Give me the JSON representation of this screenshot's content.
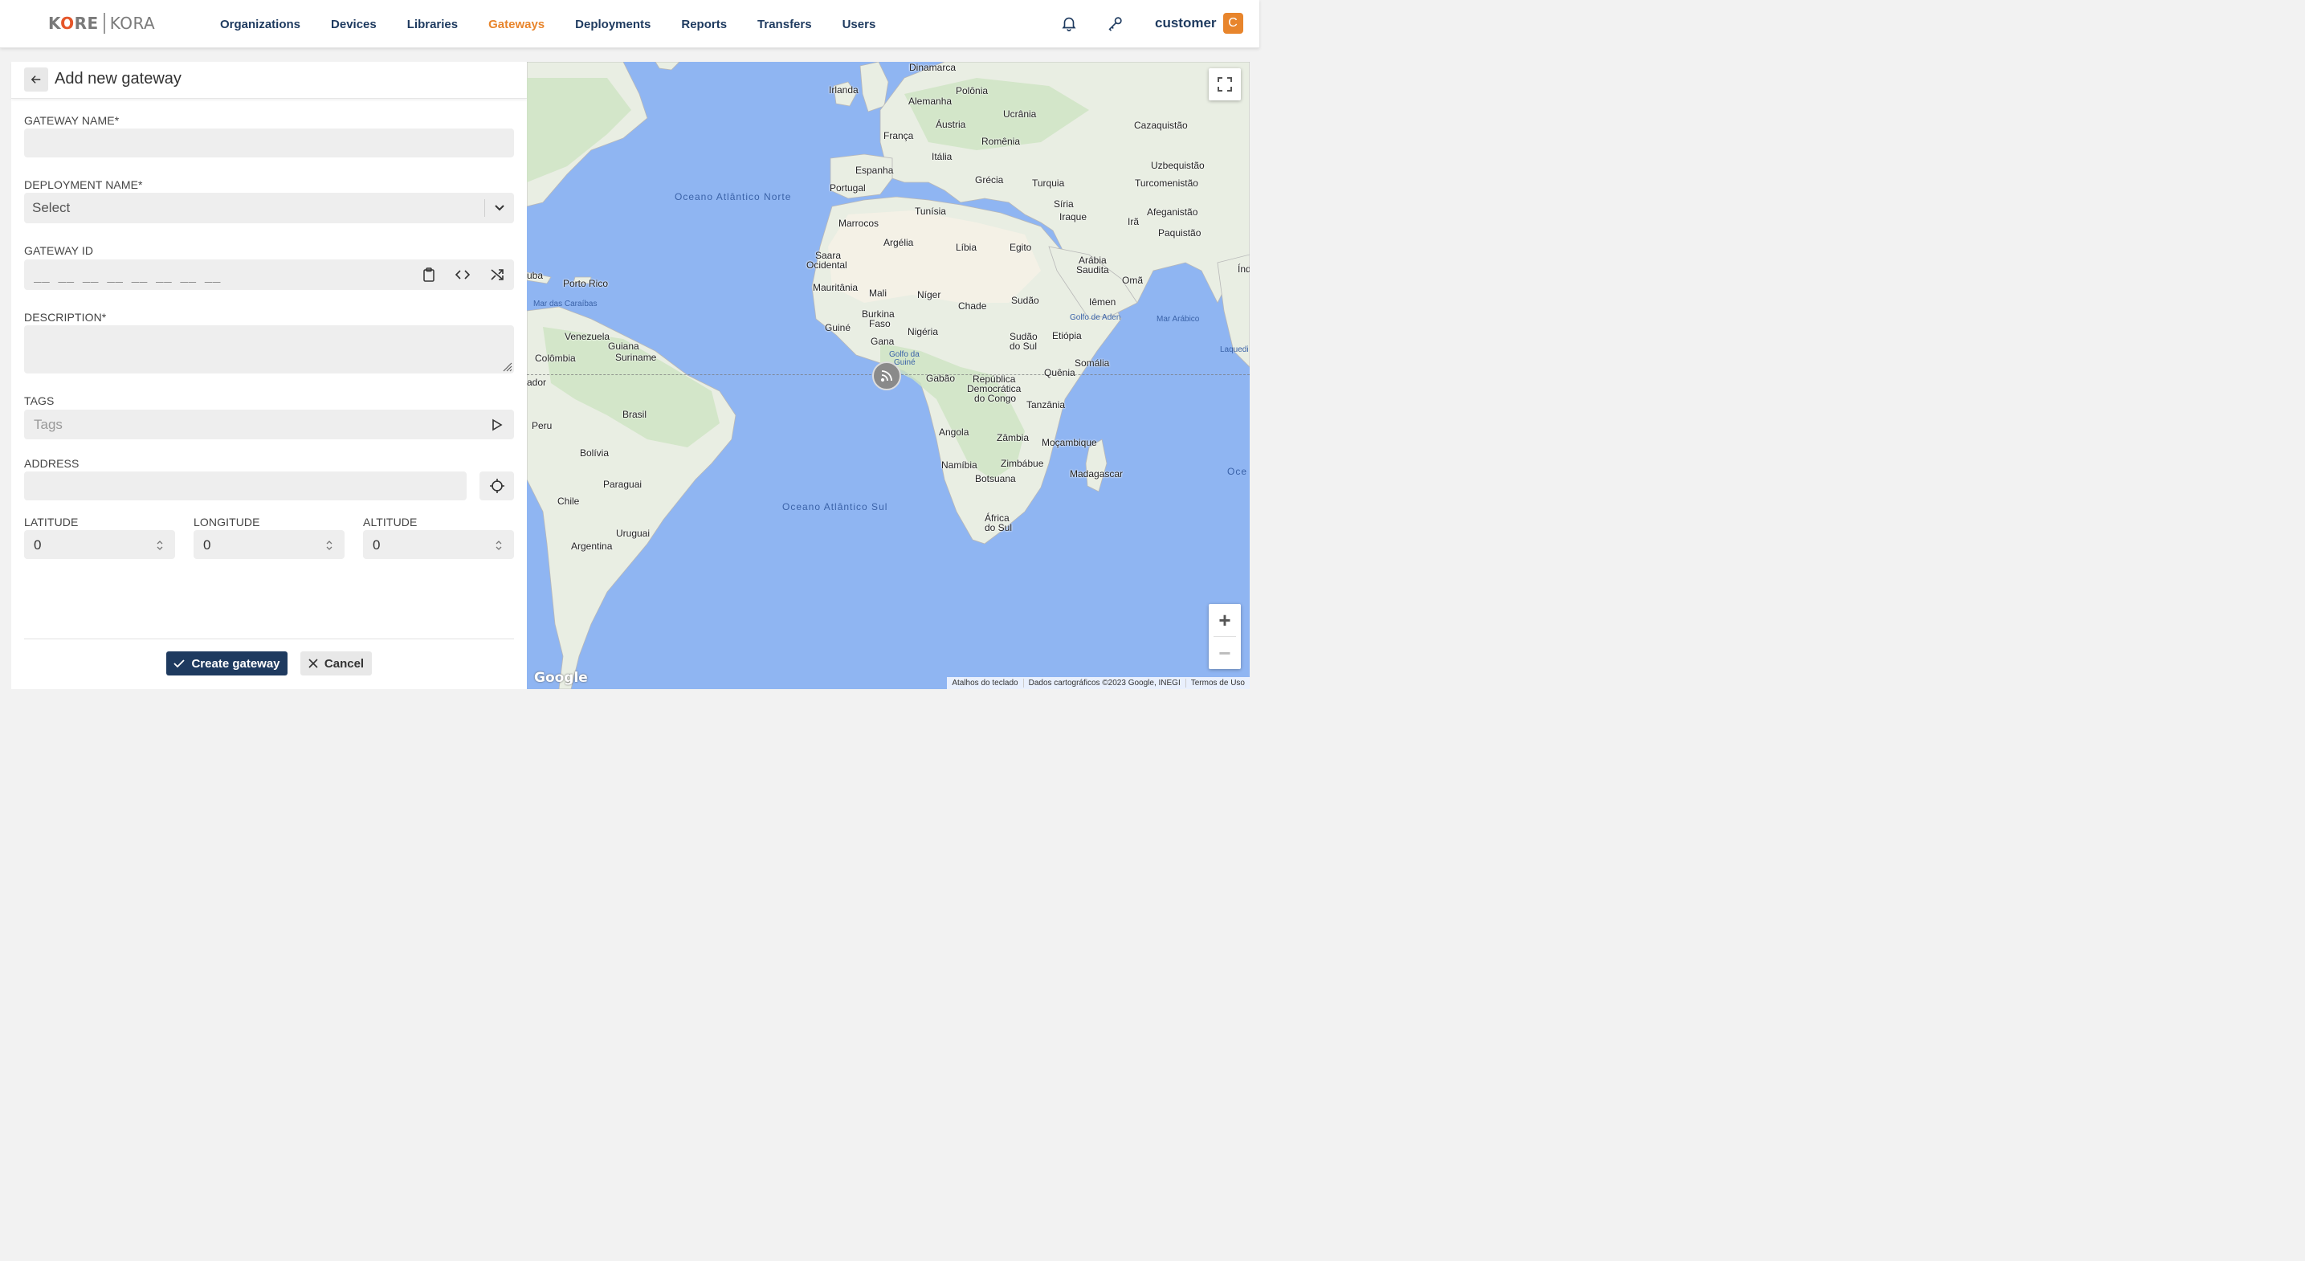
{
  "header": {
    "logo_left": "KORE",
    "logo_right": "KORA",
    "nav": [
      {
        "label": "Organizations",
        "active": false
      },
      {
        "label": "Devices",
        "active": false
      },
      {
        "label": "Libraries",
        "active": false
      },
      {
        "label": "Gateways",
        "active": true
      },
      {
        "label": "Deployments",
        "active": false
      },
      {
        "label": "Reports",
        "active": false
      },
      {
        "label": "Transfers",
        "active": false
      },
      {
        "label": "Users",
        "active": false
      }
    ],
    "notifications_icon": "bell-icon",
    "key_icon": "key-icon",
    "user_name": "customer",
    "avatar_letter": "C"
  },
  "form": {
    "title": "Add new gateway",
    "gateway_name_label": "GATEWAY NAME*",
    "gateway_name_value": "",
    "deployment_label": "DEPLOYMENT NAME*",
    "deployment_value": "Select",
    "gateway_id_label": "GATEWAY ID",
    "gateway_id_mask": "__ __ __ __ __ __ __ __",
    "description_label": "DESCRIPTION*",
    "description_value": "",
    "tags_label": "TAGS",
    "tags_placeholder": "Tags",
    "address_label": "ADDRESS",
    "address_value": "",
    "latitude_label": "LATITUDE",
    "latitude_value": "0",
    "longitude_label": "LONGITUDE",
    "longitude_value": "0",
    "altitude_label": "ALTITUDE",
    "altitude_value": "0",
    "create_label": "Create gateway",
    "cancel_label": "Cancel"
  },
  "map": {
    "labels": {
      "dinamarca": "Dinamarca",
      "irlanda": "Irlanda",
      "polonia": "Polônia",
      "alemanha": "Alemanha",
      "ucrania": "Ucrânia",
      "austria": "Áustria",
      "cazaquistao": "Cazaquistão",
      "franca": "França",
      "romenia": "Romênia",
      "italia": "Itália",
      "uzbequistao": "Uzbequistão",
      "espanha": "Espanha",
      "grecia": "Grécia",
      "turquia": "Turquia",
      "turcomenistao": "Turcomenistão",
      "portugal": "Portugal",
      "siria": "Síria",
      "iraque": "Iraque",
      "afeganistao": "Afeganistão",
      "tunisia": "Tunísia",
      "ira": "Irã",
      "paquistao": "Paquistão",
      "marrocos": "Marrocos",
      "argelia": "Argélia",
      "libia": "Líbia",
      "egito": "Egito",
      "saara": "Saara",
      "ocidental": "Ocidental",
      "arabia": "Arábia",
      "saudita": "Saudita",
      "oma": "Omã",
      "mauritania": "Mauritânia",
      "mali": "Mali",
      "niger": "Níger",
      "sudao": "Sudão",
      "chade": "Chade",
      "iemen": "Iêmen",
      "burkina": "Burkina",
      "faso": "Faso",
      "guine": "Guiné",
      "nigeria": "Nigéria",
      "golfo_aden": "Golfo de Aden",
      "mar_arabico": "Mar Arábico",
      "gana": "Gana",
      "sudao_sul_1": "Sudão",
      "sudao_sul_2": "do Sul",
      "etiopia": "Etiópia",
      "golfo_guine_1": "Golfo da",
      "golfo_guine_2": "Guiné",
      "somalia": "Somália",
      "gabao": "Gabão",
      "quenia": "Quênia",
      "rdc_1": "República",
      "rdc_2": "Democrática",
      "rdc_3": "do Congo",
      "tanzania": "Tanzânia",
      "angola": "Angola",
      "zambia": "Zâmbia",
      "mocambique": "Moçambique",
      "namibia": "Namíbia",
      "zimbabue": "Zimbábue",
      "botsuana": "Botsuana",
      "madagascar": "Madagascar",
      "africa_sul_1": "África",
      "africa_sul_2": "do Sul",
      "oceano_atl_norte": "Oceano Atlântico Norte",
      "oceano_atl_sul": "Oceano Atlântico Sul",
      "porto_rico": "Porto Rico",
      "mar_caraibas": "Mar das Caraíbas",
      "venezuela": "Venezuela",
      "guiana": "Guiana",
      "suriname": "Suriname",
      "colombia": "Colômbia",
      "equador": "ador",
      "cuba": "uba",
      "peru": "Peru",
      "brasil": "Brasil",
      "bolivia": "Bolívia",
      "paraguai": "Paraguai",
      "chile": "Chile",
      "uruguai": "Uruguai",
      "argentina": "Argentina",
      "india": "Índ",
      "laquedi": "Laquedi",
      "oceano_indico": "Oce Índ"
    },
    "attribution": [
      "Atalhos do teclado",
      "Dados cartográficos ©2023 Google, INEGI",
      "Termos de Uso"
    ],
    "google_logo": "Google",
    "zoom_in": "+",
    "zoom_out": "−"
  }
}
